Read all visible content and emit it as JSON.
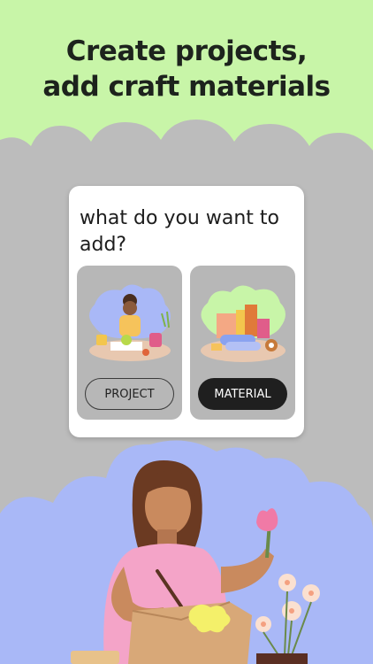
{
  "headline": {
    "line1": "Create projects,",
    "line2": "add craft materials"
  },
  "dialog": {
    "question": "what do you want to add?",
    "options": [
      {
        "label": "PROJECT",
        "style": "outline"
      },
      {
        "label": "MATERIAL",
        "style": "filled"
      }
    ]
  },
  "colors": {
    "header_green": "#c8f5a8",
    "background_gray": "#bcbcbc",
    "card_white": "#ffffff",
    "option_gray": "#b7b7b7",
    "button_dark": "#1f1f1f",
    "cloud_blue": "#a9b8f7"
  },
  "icons": {
    "project_illustration": "woman-crafting-illustration",
    "material_illustration": "craft-supplies-illustration",
    "hero_illustration": "woman-with-box-and-flowers-illustration"
  }
}
